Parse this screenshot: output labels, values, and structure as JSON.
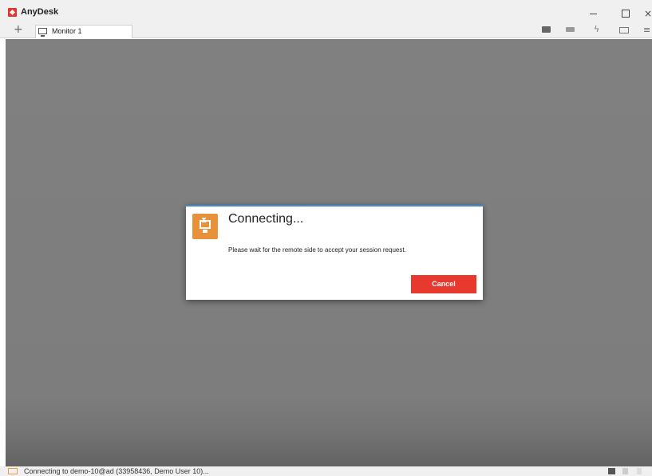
{
  "window": {
    "title": "AnyDesk",
    "minimize_glyph": "",
    "maximize_glyph": "",
    "close_glyph": "×"
  },
  "tabbar": {
    "add_tab_glyph": "+",
    "tabs": [
      {
        "label": "Monitor 1",
        "icon": "monitor-icon"
      }
    ],
    "toolbar_icons": [
      "chat-icon",
      "keyboard-icon",
      "bolt-icon",
      "display-icon",
      "menu-icon"
    ],
    "bolt_glyph": "ϟ",
    "menu_glyph": "≡"
  },
  "dialog": {
    "title": "Connecting...",
    "message": "Please wait for the remote side to accept your session request.",
    "cancel_label": "Cancel",
    "icon": "hourglass-monitor-icon",
    "hourglass_glyph": "⧗"
  },
  "statusbar": {
    "text": "Connecting to demo-10@ad (33958436, Demo User 10)...",
    "icons": [
      "recording-icon",
      "lock-icon",
      "other-icon"
    ]
  },
  "colors": {
    "accent": "#e8392f",
    "dialog_border": "#3f8ad0",
    "dialog_icon_bg": "#e8913a",
    "viewport_bg": "#808080"
  }
}
